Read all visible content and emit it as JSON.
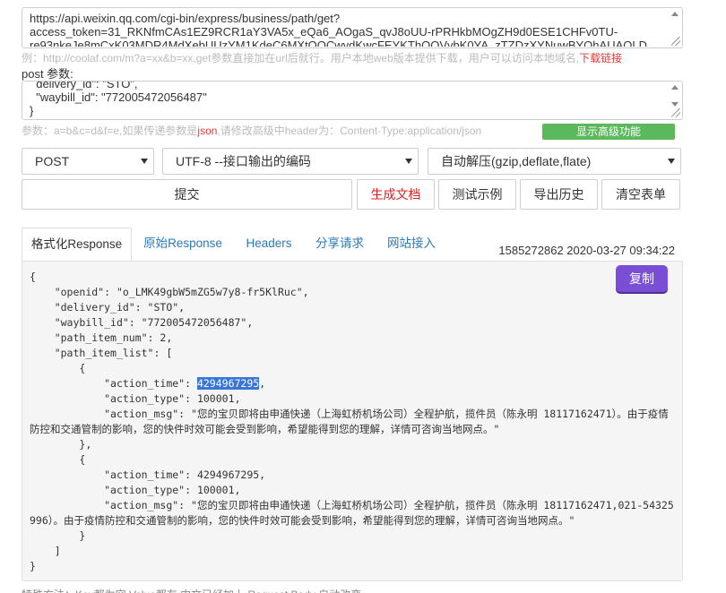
{
  "request": {
    "url_lines": [
      "https://api.weixin.qq.com/cgi-bin/express/business/path/get?",
      "access_token=31_RKNfmCAs1EZ9RCR1aY3VA5x_eQa6_AOgaS_qvJ8oUU-rPRHkbMOgZH9d0ESE1CHFv0TU-",
      "re93nkeJe8mCxK03MDR4MdXebUUzYM1KdeC6MXtOOCwydKwcFEYKThQOVvbK0YA_zTZDzXYNuwBYOhAUAOLD"
    ],
    "url_hint_prefix": "例：http://coolaf.com/m?a=xx&b=xx,get参数直接加在url后就行。用户本地web版本提供下载，用户可以访问本地域名,",
    "url_hint_link": "下载链接",
    "post_label": "post 参数:",
    "post_lines": [
      "  delivery_id\": \"STO\",",
      "  \"waybill_id\": \"772005472056487\"",
      "}"
    ],
    "post_hint_prefix": "参数：a=b&c=d&f=e,如果传递参数是",
    "post_hint_json": "json",
    "post_hint_suffix": ",请修改高级中header为：Content-Type:application/json",
    "advanced_button": "显示高级功能"
  },
  "controls": {
    "method": "POST",
    "encoding": "UTF-8 --接口输出的编码",
    "decompress": "自动解压(gzip,deflate,flate)",
    "submit": "提交",
    "generate_doc": "生成文档",
    "test_example": "测试示例",
    "export_history": "导出历史",
    "clear_form": "清空表单"
  },
  "tabs": [
    {
      "label": "格式化Response",
      "active": true
    },
    {
      "label": "原始Response",
      "active": false
    },
    {
      "label": "Headers",
      "active": false
    },
    {
      "label": "分享请求",
      "active": false
    },
    {
      "label": "网站接入",
      "active": false
    }
  ],
  "timestamp": "1585272862 2020-03-27 09:34:22",
  "copy_button": "复制",
  "response_json": {
    "open": "{",
    "openid": "    \"openid\": \"o_LMK49gbW5mZG5w7y8-fr5KlRuc\",",
    "delivery_id": "    \"delivery_id\": \"STO\",",
    "waybill_id": "    \"waybill_id\": \"772005472056487\",",
    "path_item_num": "    \"path_item_num\": 2,",
    "path_item_list_open": "    \"path_item_list\": [",
    "item_open": "        {",
    "action_time_key": "            \"action_time\": ",
    "action_time_value": "4294967295",
    "action_time_comma": ",",
    "action_type": "            \"action_type\": 100001,",
    "action_msg_1": "            \"action_msg\": \"您的宝贝即将由申通快递（上海虹桥机场公司）全程护航，揽件员（陈永明 18117162471）。由于疫情防控和交通管制的影响，您的快件时效可能会受到影响，希望能得到您的理解，详情可咨询当地网点。\"",
    "item_close_comma": "        },",
    "item2_open": "        {",
    "action_time_2": "            \"action_time\": 4294967295,",
    "action_type_2": "            \"action_type\": 100001,",
    "action_msg_2": "            \"action_msg\": \"您的宝贝即将由申通快递（上海虹桥机场公司）全程护航，揽件员（陈永明 18117162471,021-54325996）。由于疫情防控和交通管制的影响，您的快件时效可能会受到影响，希望能得到您的理解，详情可咨询当地网点。\"",
    "item2_close": "        }",
    "list_close": "    ]",
    "close": "}"
  },
  "footer_cut": "特殊方法：Key都为空  Value都有  中文已经加上  Request Body 自动改变"
}
